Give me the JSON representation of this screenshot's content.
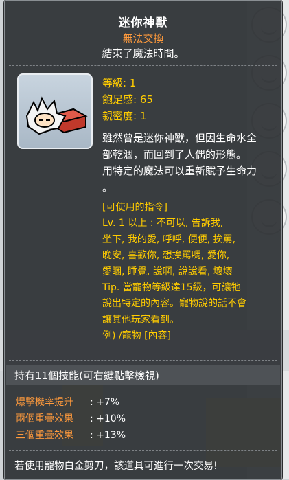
{
  "item": {
    "name": "迷你神獸",
    "trade_status": "無法交換",
    "status_text": "結束了魔法時間。"
  },
  "stats": [
    {
      "label": "等級",
      "value": "1"
    },
    {
      "label": "飽足感",
      "value": "65"
    },
    {
      "label": "親密度",
      "value": "1"
    }
  ],
  "description_lines": [
    "雖然曾是迷你神獸，但因生命水全",
    "部乾涸，而回到了人偶的形態。",
    "用特定的魔法可以重新賦予生命力",
    "。"
  ],
  "commands_lines": [
    "[可使用的指令]",
    "Lv. 1 以上 : 不可以, 告訴我,",
    "坐下, 我的愛, 呼呼, 便便, 挨罵,",
    "晚安, 喜歡你, 想挨罵嗎, 愛你,",
    "愛睏, 睡覺, 說啊, 說說看, 壞壞",
    "Tip. 當寵物等級達15級，可讓牠",
    "說出特定的內容。寵物說的話不會",
    "讓其他玩家看到。",
    "例) /寵物 [內容]"
  ],
  "skills_text": "持有11個技能(可右鍵點擊檢視)",
  "bonuses": [
    {
      "label": "爆擊機率提升",
      "value": "+7%"
    },
    {
      "label": "兩個重疊效果",
      "value": "+10%"
    },
    {
      "label": "三個重疊效果",
      "value": "+13%"
    }
  ],
  "footer_text": "若使用寵物白金剪刀，該道具可進行一次交易!",
  "colors": {
    "title": "#ffffff",
    "orange": "#ff9a3c",
    "yellow": "#ffcc00",
    "tooltip_bg": "#2d3033"
  },
  "icon": "mini-beast-pet-doll-icon"
}
